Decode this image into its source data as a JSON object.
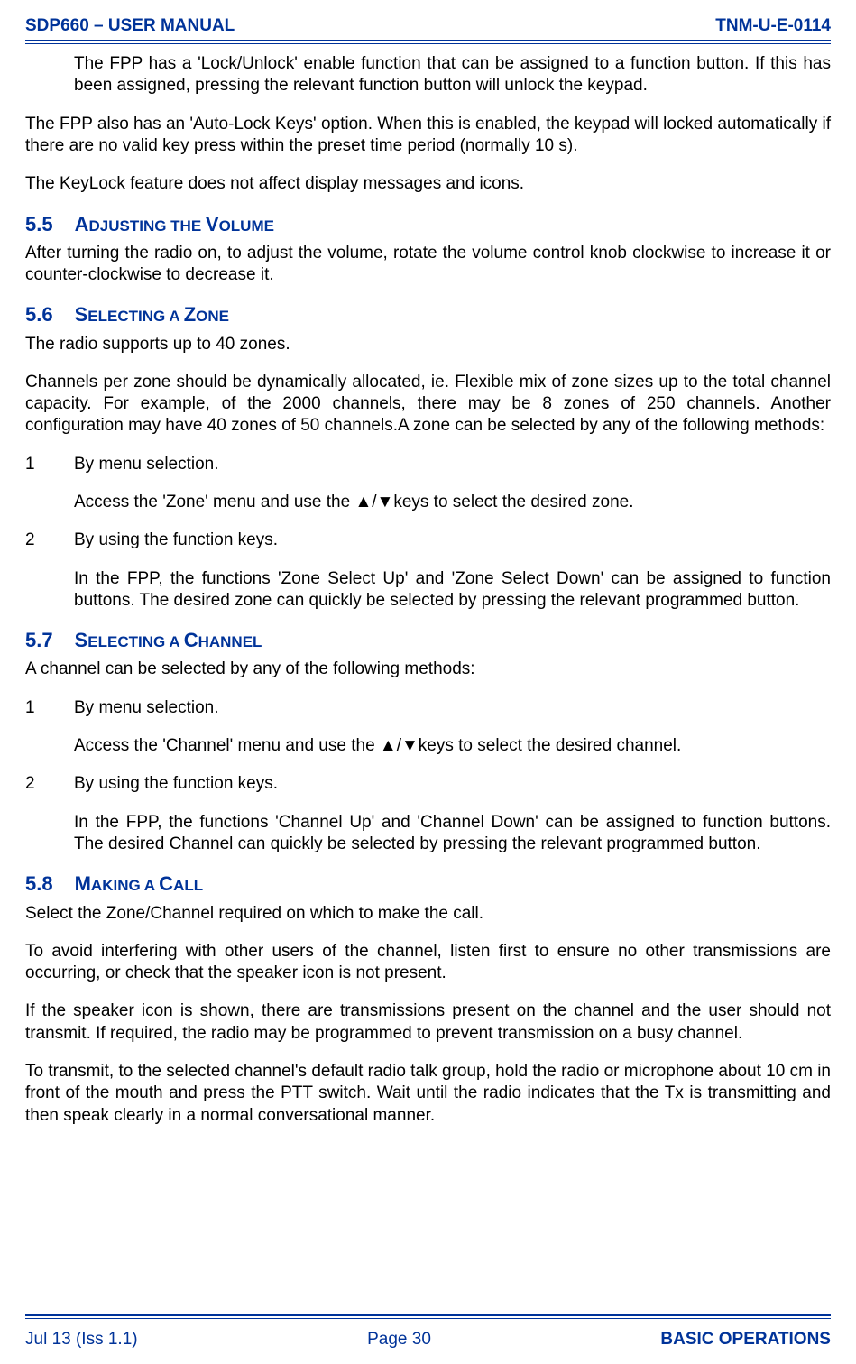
{
  "header": {
    "left": "SDP660 – USER MANUAL",
    "right": "TNM-U-E-0114"
  },
  "p1": "The FPP has a 'Lock/Unlock' enable function that can be assigned to a function button.  If this has been assigned, pressing the relevant function button will unlock the keypad.",
  "p2": "The FPP also has an 'Auto-Lock Keys' option.  When this is enabled, the keypad will locked automatically if there are no valid key press within the preset time period (normally 10 s).",
  "p3": "The KeyLock feature does not affect display messages and icons.",
  "s55": {
    "num": "5.5",
    "cap": "A",
    "rest": "DJUSTING THE ",
    "cap2": "V",
    "rest2": "OLUME",
    "p1": "After turning the radio on, to adjust the volume, rotate the volume control knob clockwise to increase it or counter-clockwise to decrease it."
  },
  "s56": {
    "num": "5.6",
    "cap": "S",
    "rest": "ELECTING A ",
    "cap2": "Z",
    "rest2": "ONE",
    "p1": "The radio supports up to 40 zones.",
    "p2": "Channels per zone should be dynamically allocated, ie. Flexible mix of zone sizes up to the total channel capacity. For example, of the 2000 channels, there may be 8 zones of 250 channels. Another configuration may have 40 zones of 50 channels.A zone can be selected by any of the following methods:",
    "i1n": "1",
    "i1t": "By menu selection.",
    "i1p": "Access the 'Zone' menu and use the ▲/▼keys to select the desired zone.",
    "i2n": "2",
    "i2t": "By using the function keys.",
    "i2p": "In the FPP, the functions 'Zone Select Up' and 'Zone Select Down' can be assigned to function buttons.  The desired zone can quickly be selected by pressing the relevant programmed button."
  },
  "s57": {
    "num": "5.7",
    "cap": "S",
    "rest": "ELECTING A ",
    "cap2": "C",
    "rest2": "HANNEL",
    "p1": "A channel can be selected by any of the following methods:",
    "i1n": "1",
    "i1t": "By menu selection.",
    "i1p": "Access the 'Channel' menu and use the ▲/▼keys to select the desired channel.",
    "i2n": "2",
    "i2t": "By using the function keys.",
    "i2p": "In the FPP, the functions 'Channel Up' and 'Channel Down' can be assigned to function buttons.  The desired Channel can quickly be selected by pressing the relevant programmed button."
  },
  "s58": {
    "num": "5.8",
    "cap": "M",
    "rest": "AKING A ",
    "cap2": "C",
    "rest2": "ALL",
    "p1": "Select the Zone/Channel required on which to make the call.",
    "p2": "To avoid interfering with other users of the channel, listen first to ensure no other transmissions are occurring, or check that the speaker icon is not present.",
    "p3": "If the speaker icon is shown, there are transmissions present on the channel and the user should not transmit.  If required, the radio may be programmed to prevent transmission on a busy channel.",
    "p4": "To transmit, to the selected channel's default radio talk group, hold the radio or microphone about 10 cm in front of the mouth and press the PTT switch.  Wait until the radio indicates that the Tx is transmitting and then speak clearly in a normal conversational manner."
  },
  "footer": {
    "left": "Jul 13 (Iss 1.1)",
    "center": "Page 30",
    "right": "BASIC OPERATIONS"
  }
}
